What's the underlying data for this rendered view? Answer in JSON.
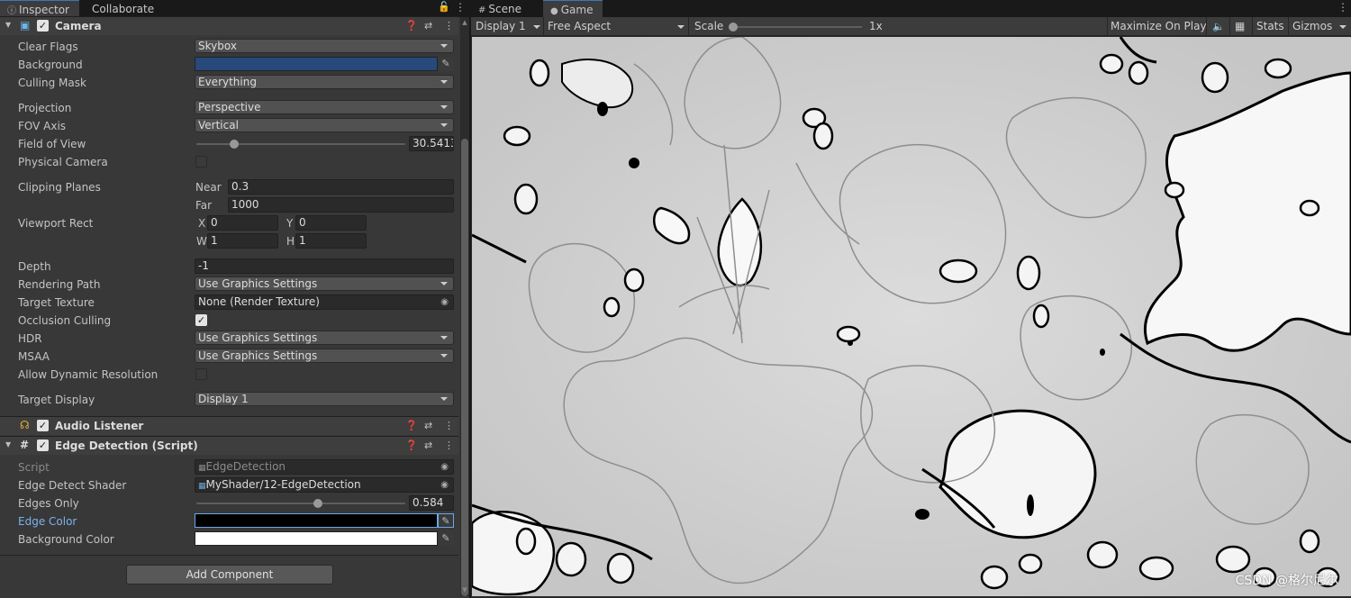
{
  "inspector": {
    "tabs": {
      "inspector": "Inspector",
      "collaborate": "Collaborate"
    },
    "camera": {
      "title": "Camera",
      "clear_flags": {
        "label": "Clear Flags",
        "value": "Skybox"
      },
      "background": {
        "label": "Background",
        "color": "#27497c"
      },
      "culling_mask": {
        "label": "Culling Mask",
        "value": "Everything"
      },
      "projection": {
        "label": "Projection",
        "value": "Perspective"
      },
      "fov_axis": {
        "label": "FOV Axis",
        "value": "Vertical"
      },
      "field_of_view": {
        "label": "Field of View",
        "value": "30.5413",
        "level": 0.18
      },
      "physical_camera": {
        "label": "Physical Camera",
        "checked": false
      },
      "clipping_planes": {
        "label": "Clipping Planes",
        "near_label": "Near",
        "near": "0.3",
        "far_label": "Far",
        "far": "1000"
      },
      "viewport_rect": {
        "label": "Viewport Rect",
        "x_label": "X",
        "x": "0",
        "y_label": "Y",
        "y": "0",
        "w_label": "W",
        "w": "1",
        "h_label": "H",
        "h": "1"
      },
      "depth": {
        "label": "Depth",
        "value": "-1"
      },
      "rendering_path": {
        "label": "Rendering Path",
        "value": "Use Graphics Settings"
      },
      "target_texture": {
        "label": "Target Texture",
        "value": "None (Render Texture)"
      },
      "occlusion_culling": {
        "label": "Occlusion Culling",
        "checked": true
      },
      "hdr": {
        "label": "HDR",
        "value": "Use Graphics Settings"
      },
      "msaa": {
        "label": "MSAA",
        "value": "Use Graphics Settings"
      },
      "allow_dynamic_resolution": {
        "label": "Allow Dynamic Resolution",
        "checked": false
      },
      "target_display": {
        "label": "Target Display",
        "value": "Display 1"
      }
    },
    "audio_listener": {
      "title": "Audio Listener"
    },
    "edge_detection": {
      "title": "Edge Detection (Script)",
      "script": {
        "label": "Script",
        "value": "EdgeDetection"
      },
      "edge_detect_shader": {
        "label": "Edge Detect Shader",
        "value": "MyShader/12-EdgeDetection"
      },
      "edges_only": {
        "label": "Edges Only",
        "value": "0.584",
        "level": 0.584
      },
      "edge_color": {
        "label": "Edge Color",
        "color": "#000000"
      },
      "background_color": {
        "label": "Background Color",
        "color": "#ffffff"
      }
    },
    "add_component": "Add Component"
  },
  "game": {
    "tabs": {
      "scene": "Scene",
      "game": "Game"
    },
    "toolbar": {
      "display": "Display 1",
      "aspect": "Free Aspect",
      "scale_label": "Scale",
      "scale_value": "1x",
      "maximize": "Maximize On Play",
      "stats": "Stats",
      "gizmos": "Gizmos"
    },
    "watermark": "CSDN @格尔尼尔"
  },
  "icons": [
    "info-icon",
    "lock-icon",
    "kebab-menu-icon",
    "camera-icon",
    "help-icon",
    "preset-icon",
    "headphones-icon",
    "script-hash-icon",
    "eyedropper-icon",
    "object-picker-icon",
    "speaker-icon",
    "grid-icon"
  ]
}
